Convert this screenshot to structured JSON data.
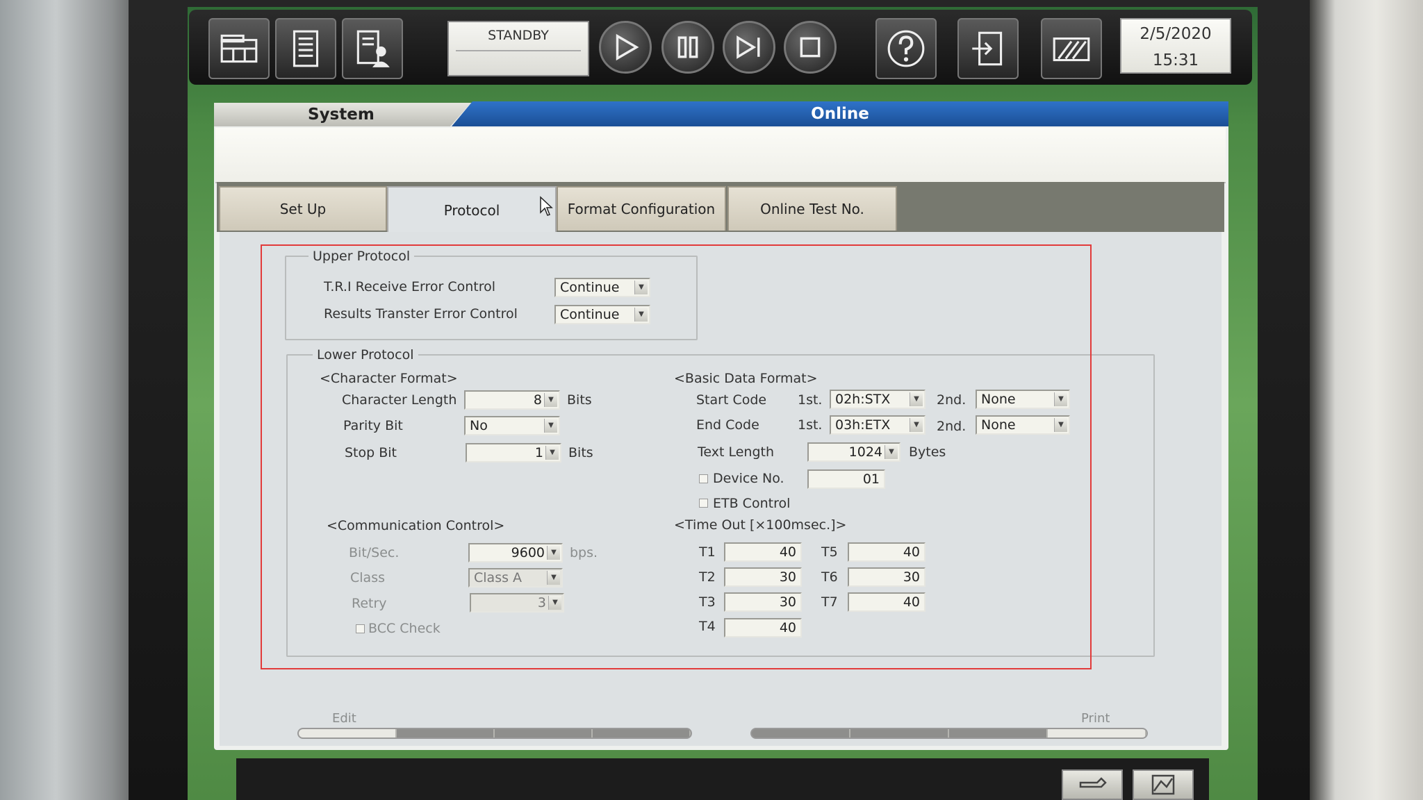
{
  "toolbar": {
    "left_icons": [
      "rack-icon",
      "list-icon",
      "worklist-user-icon"
    ],
    "status": "STANDBY",
    "controls": [
      "play-icon",
      "pause-icon",
      "step-icon",
      "stop-icon"
    ],
    "right_icons": [
      "help-icon",
      "logout-icon",
      "report-icon"
    ],
    "date": "2/5/2020",
    "time": "15:31"
  },
  "header": {
    "left_title": "System",
    "right_title": "Online"
  },
  "tabs": [
    {
      "label": "Set Up"
    },
    {
      "label": "Protocol"
    },
    {
      "label": "Format Configuration"
    },
    {
      "label": "Online Test No."
    }
  ],
  "upper_protocol": {
    "title": "Upper Protocol",
    "tri_label": "T.R.I Receive Error Control",
    "tri_value": "Continue",
    "results_label": "Results Transter Error Control",
    "results_value": "Continue"
  },
  "lower_protocol": {
    "title": "Lower Protocol",
    "char_format": {
      "title": "<Character Format>",
      "char_length_label": "Character Length",
      "char_length_value": "8",
      "char_length_unit": "Bits",
      "parity_label": "Parity Bit",
      "parity_value": "No",
      "stop_label": "Stop Bit",
      "stop_value": "1",
      "stop_unit": "Bits"
    },
    "basic_format": {
      "title": "<Basic Data Format>",
      "start_label": "Start Code",
      "first": "1st.",
      "second": "2nd.",
      "start_1st": "02h:STX",
      "start_2nd": "None",
      "end_label": "End Code",
      "end_1st": "03h:ETX",
      "end_2nd": "None",
      "text_length_label": "Text Length",
      "text_length_value": "1024",
      "text_length_unit": "Bytes",
      "device_label": "Device No.",
      "device_value": "01",
      "etb_label": "ETB Control"
    },
    "comm_control": {
      "title": "<Communication Control>",
      "bitsec_label": "Bit/Sec.",
      "bitsec_value": "9600",
      "bitsec_unit": "bps.",
      "class_label": "Class",
      "class_value": "Class A",
      "retry_label": "Retry",
      "retry_value": "3",
      "bcc_label": "BCC Check"
    },
    "timeout": {
      "title": "<Time Out [×100msec.]>",
      "t1_label": "T1",
      "t1": "40",
      "t2_label": "T2",
      "t2": "30",
      "t3_label": "T3",
      "t3": "30",
      "t4_label": "T4",
      "t4": "40",
      "t5_label": "T5",
      "t5": "40",
      "t6_label": "T6",
      "t6": "30",
      "t7_label": "T7",
      "t7": "40"
    }
  },
  "footer": {
    "edit_label": "Edit",
    "print_label": "Print"
  },
  "colors": {
    "header_blue": "#1f5aa8",
    "screen_green": "#5a9a4e",
    "highlight_red": "#e23a3a"
  }
}
